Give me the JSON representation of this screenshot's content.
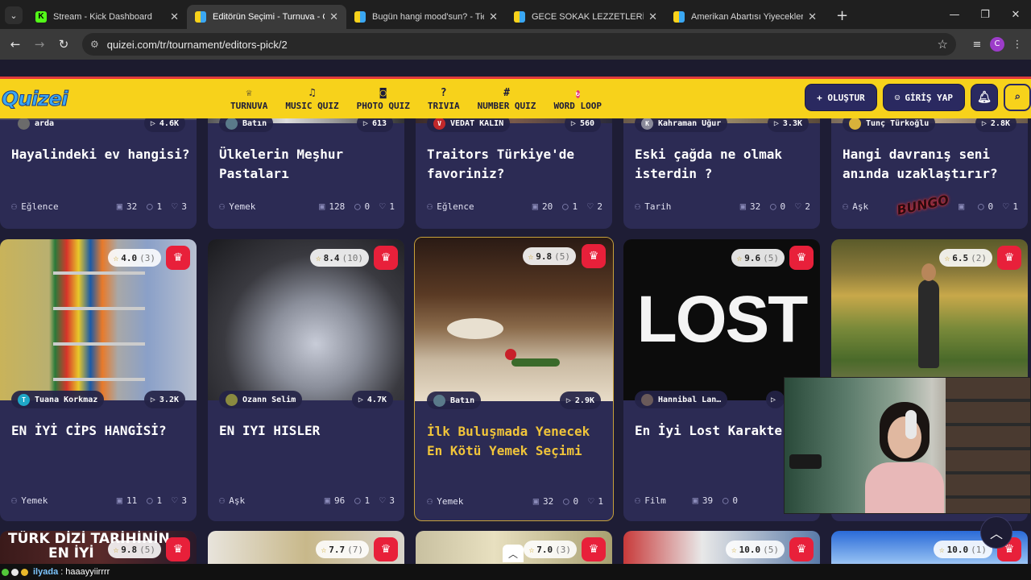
{
  "browser": {
    "tabs": [
      {
        "title": "Stream - Kick Dashboard",
        "favicon_color": "#53fc18",
        "active": false
      },
      {
        "title": "Editörün Seçimi - Turnuva - Qu",
        "favicon_color": "#f7d21b",
        "active": true
      },
      {
        "title": "Bugün hangi mood'sun? - Tier",
        "favicon_color": "#f7d21b",
        "active": false
      },
      {
        "title": "GECE SOKAK LEZZETLERİ - Tier",
        "favicon_color": "#f7d21b",
        "active": false
      },
      {
        "title": "Amerikan Abartısı Yiyecekler - ",
        "favicon_color": "#f7d21b",
        "active": false
      }
    ],
    "url": "quizei.com/tr/tournament/editors-pick/2",
    "profile_initial": "C"
  },
  "header": {
    "logo": "Quizei",
    "nav": [
      {
        "label": "TURNUVA",
        "icon": "trophy-icon",
        "glyph": "🏆"
      },
      {
        "label": "MUSIC QUIZ",
        "icon": "music-note-icon",
        "glyph": "♫"
      },
      {
        "label": "PHOTO QUIZ",
        "icon": "camera-icon",
        "glyph": "◙"
      },
      {
        "label": "TRIVIA",
        "icon": "question-icon",
        "glyph": "?"
      },
      {
        "label": "NUMBER QUIZ",
        "icon": "hash-icon",
        "glyph": "#"
      },
      {
        "label": "WORD LOOP",
        "icon": "word-loop-icon",
        "glyph": "↻"
      }
    ],
    "create_label": "+ OLUŞTUR",
    "login_label": "GİRİŞ YAP"
  },
  "row1": [
    {
      "author": "arda",
      "plays": "4.6K",
      "title": "Hayalindeki ev hangisi?",
      "category": "Eğlence",
      "items": "32",
      "comments": "1",
      "likes": "3",
      "avatar": "#6b6b6b",
      "avatar_letter": ""
    },
    {
      "author": "Batın",
      "plays": "613",
      "title": "Ülkelerin Meşhur Pastaları",
      "category": "Yemek",
      "items": "128",
      "comments": "0",
      "likes": "1",
      "avatar": "#5a7a8a",
      "avatar_letter": ""
    },
    {
      "author": "VEDAT KALIN",
      "plays": "560",
      "title": "Traitors Türkiye'de favoriniz?",
      "category": "Eğlence",
      "items": "20",
      "comments": "1",
      "likes": "2",
      "avatar": "#c0282a",
      "avatar_letter": "V"
    },
    {
      "author": "Kahraman Uğur",
      "plays": "3.3K",
      "title": "Eski çağda ne olmak isterdin ?",
      "category": "Tarih",
      "items": "32",
      "comments": "0",
      "likes": "2",
      "avatar": "#8a8a9a",
      "avatar_letter": "K"
    },
    {
      "author": "Tunç Türkoğlu",
      "plays": "2.8K",
      "title": "Hangi davranış seni anında uzaklaştırır?",
      "category": "Aşk",
      "items": "",
      "comments": "0",
      "likes": "1",
      "avatar": "#d8b23a",
      "avatar_letter": ""
    }
  ],
  "row2": [
    {
      "author": "Tuana Korkmaz",
      "plays": "3.2K",
      "title": "EN İYİ CİPS HANGİSİ?",
      "category": "Yemek",
      "items": "11",
      "comments": "1",
      "likes": "3",
      "rating": "4.0",
      "votes": "(3)",
      "avatar": "#1fa8c8",
      "avatar_letter": "T"
    },
    {
      "author": "Ozann Selim",
      "plays": "4.7K",
      "title": "EN IYI HISLER",
      "category": "Aşk",
      "items": "96",
      "comments": "1",
      "likes": "3",
      "rating": "8.4",
      "votes": "(10)",
      "avatar": "#8a8a40",
      "avatar_letter": ""
    },
    {
      "author": "Batın",
      "plays": "2.9K",
      "title": "İlk Buluşmada Yenecek En Kötü Yemek Seçimi",
      "category": "Yemek",
      "items": "32",
      "comments": "0",
      "likes": "1",
      "rating": "9.8",
      "votes": "(5)",
      "avatar": "#5a7a8a",
      "avatar_letter": ""
    },
    {
      "author": "Hannibal Lan…",
      "plays": "",
      "title": "En İyi Lost Karakte",
      "category": "Film",
      "items": "39",
      "comments": "0",
      "likes": "",
      "rating": "9.6",
      "votes": "(5)",
      "avatar": "#6a5a5a",
      "avatar_letter": "",
      "image_text": "LOST"
    },
    {
      "author": "",
      "plays": "",
      "title": "",
      "category": "",
      "items": "",
      "comments": "",
      "likes": "",
      "rating": "6.5",
      "votes": "(2)",
      "avatar": "",
      "avatar_letter": ""
    }
  ],
  "row3": [
    {
      "rating": "9.8",
      "votes": "(5)",
      "image_text_1": "TÜRK DİZİ TARİHİNİN",
      "image_text_2": "EN İYİ"
    },
    {
      "rating": "7.7",
      "votes": "(7)"
    },
    {
      "rating": "7.0",
      "votes": "(3)"
    },
    {
      "rating": "10.0",
      "votes": "(5)"
    },
    {
      "rating": "10.0",
      "votes": "(1)"
    }
  ],
  "overlay": {
    "bungo": "BUNGO"
  },
  "chat": {
    "user": "ilyada",
    "message": ": haaayyiirrrr"
  }
}
